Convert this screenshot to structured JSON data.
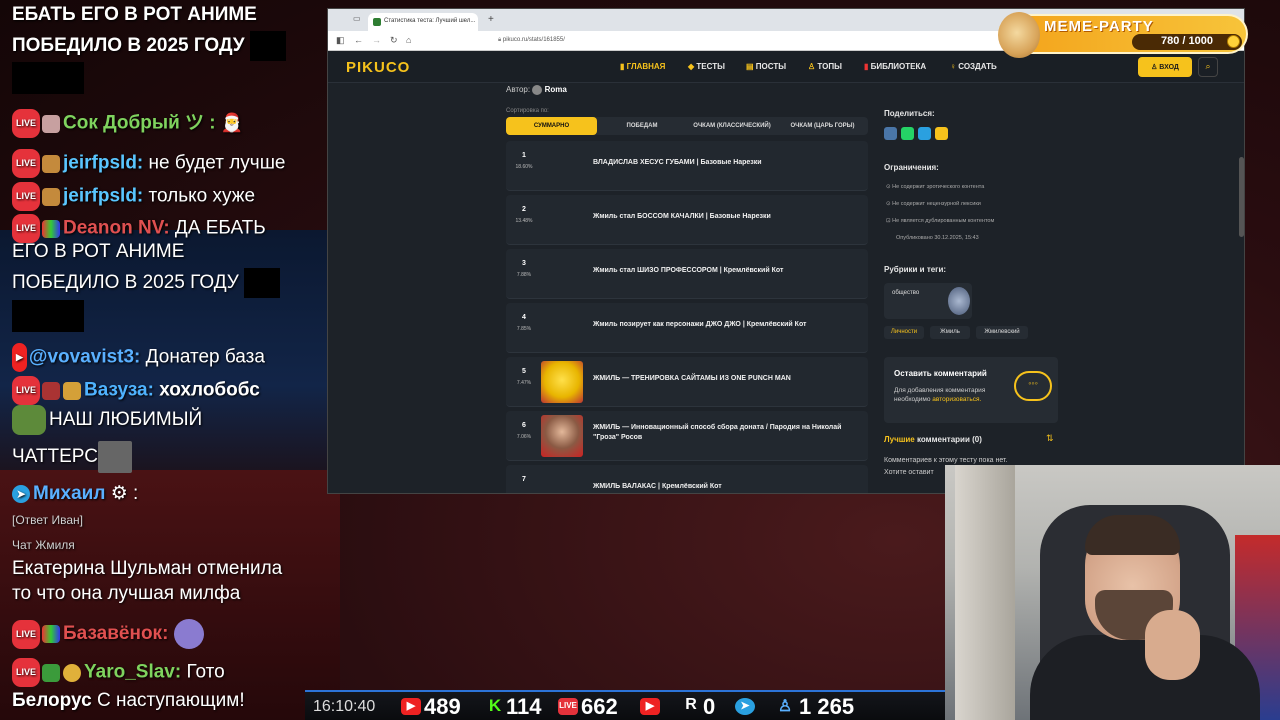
{
  "chat": {
    "m1": "ЕБАТЬ ЕГО В РОТ АНИМЕ",
    "m1b": "ПОБЕДИЛО В 2025 ГОДУ",
    "m2_nick": "Сок Добрый ツ :",
    "m3_nick": "jeirfpsld:",
    "m3_text": "не будет лучше",
    "m4_nick": "jeirfpsld:",
    "m4_text": "только хуже",
    "m5_nick": "Deanon NV:",
    "m5_text": "ДА ЕБАТЬ",
    "m5b": "ЕГО В РОТ АНИМЕ",
    "m5c": "ПОБЕДИЛО В 2025 ГОДУ",
    "m6_nick": "@vovavist3:",
    "m6_text": "Донатер база",
    "m7_nick": "Вазуза:",
    "m7_text": "хохлобобс",
    "m8": "НАШ ЛЮБИМЫЙ",
    "m8b": "ЧАТТЕРС",
    "m9_nick": "Михаил",
    "m9_suffix": ":",
    "m9_reply": "[Ответ Иван]",
    "m9_ctx": "Чат Жмиля",
    "m9_text": "Екатерина Шульман отменила",
    "m9b": "то что она лучшая милфа",
    "m10_nick": "Базавёнок:",
    "m11_nick": "Yaro_Slav:",
    "m11_text": "Гото",
    "m12_nick": "Белорус",
    "m12_text": "С наступающим!",
    "live": "LIVE"
  },
  "browser": {
    "tab_title": "Статистика теста: Лучший шел...",
    "url": "pikuco.ru/stats/161855/",
    "logo": "PIKUCO",
    "menu": [
      "ГЛАВНАЯ",
      "ТЕСТЫ",
      "ПОСТЫ",
      "ТОПЫ",
      "БИБЛИОТЕКА",
      "СОЗДАТЬ"
    ],
    "login": "ВХОД",
    "author_label": "Автор:",
    "author": "Roma",
    "sort_label": "Сортировка по:",
    "sorts": [
      "СУММАРНО",
      "ПОБЕДАМ",
      "ОЧКАМ (КЛАССИЧЕСКИЙ)",
      "ОЧКАМ (ЦАРЬ ГОРЫ)"
    ],
    "rows": [
      {
        "num": "1",
        "pct": "18.60%",
        "title": "ВЛАДИСЛАВ ХЕСУС ГУБАМИ | Базовые Нарезки"
      },
      {
        "num": "2",
        "pct": "13.48%",
        "title": "Жмиль стал БОССОМ КАЧАЛКИ | Базовые Нарезки"
      },
      {
        "num": "3",
        "pct": "7.88%",
        "title": "Жмиль стал ШИЗО ПРОФЕССОРОМ | Кремлёвский Кот"
      },
      {
        "num": "4",
        "pct": "7.85%",
        "title": "Жмиль позирует как персонажи ДЖО ДЖО | Кремлёвский Кот"
      },
      {
        "num": "5",
        "pct": "7.47%",
        "title": "ЖМИЛЬ — ТРЕНИРОВКА САЙТАМЫ ИЗ ONE PUNCH MAN"
      },
      {
        "num": "6",
        "pct": "7.06%",
        "title": "ЖМИЛЬ — Инновационный способ сбора доната / Пародия на Николай \"Гроза\" Росов"
      },
      {
        "num": "7",
        "pct": "",
        "title": "ЖМИЛЬ ВАЛАКАС | Кремлёвский Кот"
      }
    ],
    "share": "Поделиться:",
    "limits": "Ограничения:",
    "limit_items": [
      "Не содержит эротического контента",
      "Не содержит нецензурной лексики",
      "Не является дублированным контентом",
      "Опубликовано 30.12.2025, 15:43"
    ],
    "rubrics": "Рубрики и теги:",
    "rubric": "общество",
    "tags": [
      "Личности",
      "Жмиль",
      "Жмилевский"
    ],
    "comment_title": "Оставить комментарий",
    "comment_text": "Для добавления комментария необходимо",
    "comment_link": "авторизоваться.",
    "best": "Лучшие",
    "comments": "комментарии (0)",
    "no_comments": "Комментариев к этому тесту пока нет.",
    "no_comments2": "Хотите оставит"
  },
  "meme": {
    "title": "MEME-PARTY",
    "progress": "780 / 1000",
    "progress_fraction": 0.78
  },
  "bottom": {
    "clock": "16:10:40",
    "yt": "489",
    "kick": "114",
    "vk": "662",
    "rumble": "0",
    "tg": "1 265"
  },
  "colors": {
    "accent": "#f6c21c",
    "live": "#e5323b",
    "bar": "#2c74d8"
  }
}
